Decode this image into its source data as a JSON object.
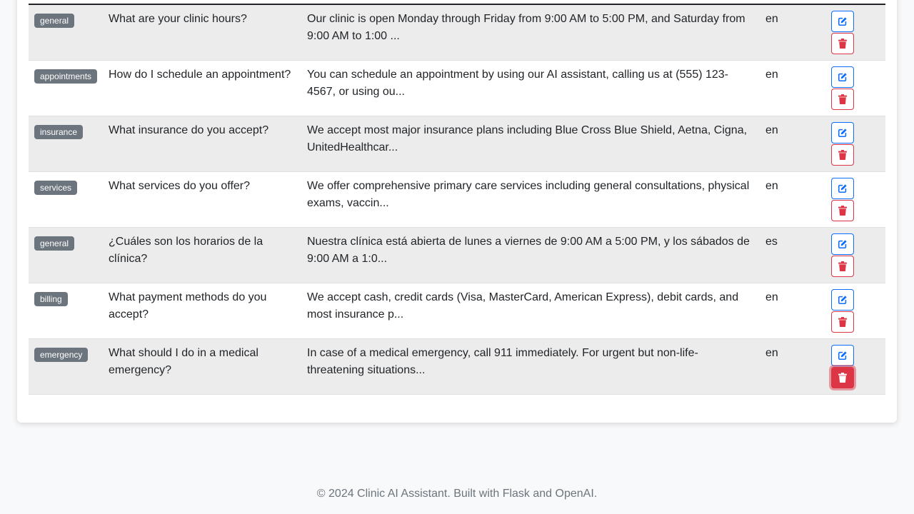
{
  "faqs": {
    "rows": [
      {
        "category": "general",
        "question": "What are your clinic hours?",
        "answer": "Our clinic is open Monday through Friday from 9:00 AM to 5:00 PM, and Saturday from 9:00 AM to 1:00 ...",
        "language": "en"
      },
      {
        "category": "appointments",
        "question": "How do I schedule an appointment?",
        "answer": "You can schedule an appointment by using our AI assistant, calling us at (555) 123-4567, or using ou...",
        "language": "en"
      },
      {
        "category": "insurance",
        "question": "What insurance do you accept?",
        "answer": "We accept most major insurance plans including Blue Cross Blue Shield, Aetna, Cigna, UnitedHealthcar...",
        "language": "en"
      },
      {
        "category": "services",
        "question": "What services do you offer?",
        "answer": "We offer comprehensive primary care services including general consultations, physical exams, vaccin...",
        "language": "en"
      },
      {
        "category": "general",
        "question": "¿Cuáles son los horarios de la clínica?",
        "answer": "Nuestra clínica está abierta de lunes a viernes de 9:00 AM a 5:00 PM, y los sábados de 9:00 AM a 1:0...",
        "language": "es"
      },
      {
        "category": "billing",
        "question": "What payment methods do you accept?",
        "answer": "We accept cash, credit cards (Visa, MasterCard, American Express), debit cards, and most insurance p...",
        "language": "en"
      },
      {
        "category": "emergency",
        "question": "What should I do in a medical emergency?",
        "answer": "In case of a medical emergency, call 911 immediately. For urgent but non-life-threatening situations...",
        "language": "en"
      }
    ],
    "edit_icon": "pencil-square-icon",
    "delete_icon": "trash-icon"
  },
  "footer": {
    "text": "© 2024 Clinic AI Assistant. Built with Flask and OpenAI."
  },
  "colors": {
    "edit": "#0d6efd",
    "delete": "#dc3545",
    "badge": "#6c757d",
    "row_stripe": "#ececec",
    "footer_text": "#6c757d",
    "background": "#f8f9fa"
  }
}
